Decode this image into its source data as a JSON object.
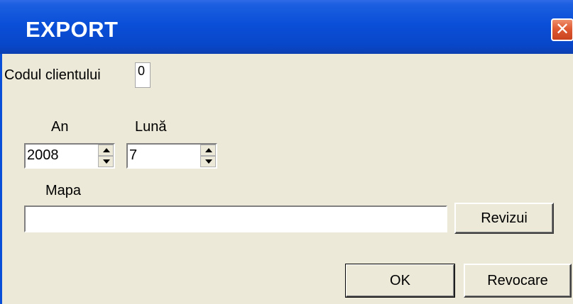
{
  "window": {
    "title": "EXPORT",
    "close_label": "✕"
  },
  "form": {
    "client_code_label": "Codul clientului",
    "client_code_value": "0",
    "year_label": "An",
    "year_value": "2008",
    "month_label": "Lună",
    "month_value": "7",
    "folder_label": "Mapa",
    "folder_value": ""
  },
  "buttons": {
    "browse_label": "Revizui",
    "ok_label": "OK",
    "cancel_label": "Revocare"
  }
}
